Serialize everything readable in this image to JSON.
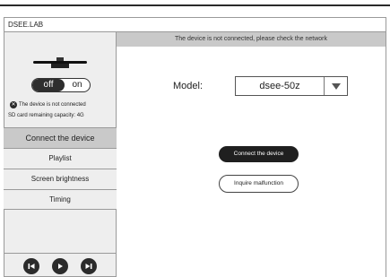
{
  "window": {
    "title": "DSEE.LAB"
  },
  "sidebar": {
    "toggle": {
      "off_label": "off",
      "on_label": "on",
      "state": "off"
    },
    "status": {
      "connection_text": "The device is not connected",
      "sd_text": "SD card remaining capacity: 4G"
    },
    "menu": [
      {
        "label": "Connect the device",
        "active": true
      },
      {
        "label": "Playlist",
        "active": false
      },
      {
        "label": "Screen brightness",
        "active": false
      },
      {
        "label": "Timing",
        "active": false
      }
    ],
    "player": {
      "icons": [
        "skip-previous-icon",
        "play-icon",
        "skip-next-icon"
      ]
    }
  },
  "main": {
    "banner": "The device is not connected, please check the network",
    "model": {
      "label": "Model:",
      "value": "dsee-50z"
    },
    "buttons": {
      "connect": "Connect the device",
      "inquire": "Inquire malfunction"
    }
  },
  "colors": {
    "accent_dark": "#1f1f1f",
    "sidebar_bg": "#eeeeee",
    "active_item_bg": "#c9c9c9",
    "banner_bg": "#c9c9c9"
  }
}
